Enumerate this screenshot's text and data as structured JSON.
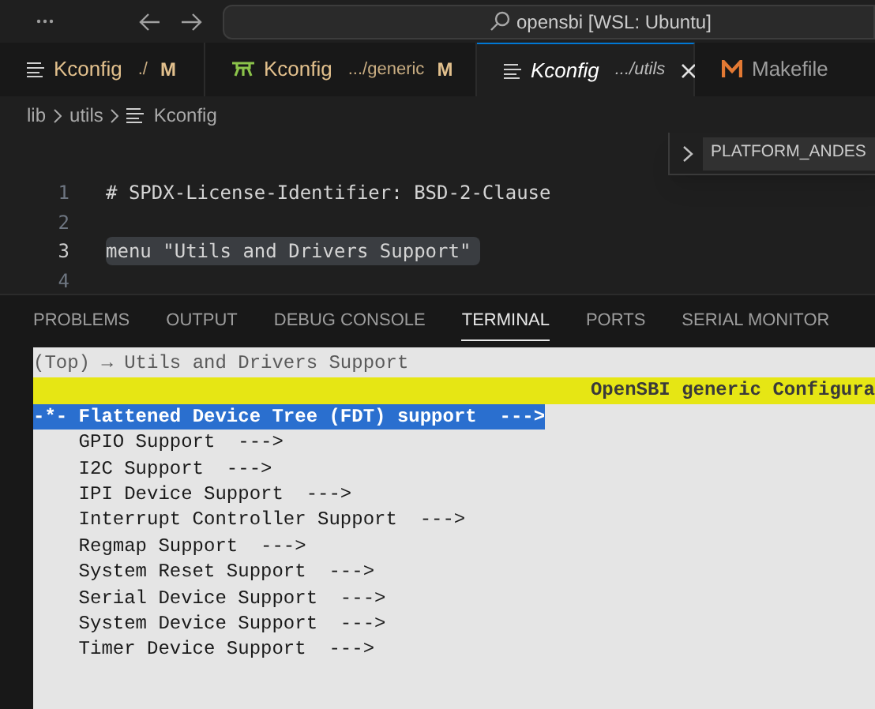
{
  "title_bar": {
    "search_text": "opensbi [WSL: Ubuntu]"
  },
  "tabs": [
    {
      "kind": "lines",
      "label": "Kconfig",
      "description": "./",
      "decoration": "M",
      "selected": false,
      "preview": false,
      "closable": false
    },
    {
      "kind": "tree",
      "label": "Kconfig",
      "description": ".../generic",
      "decoration": "M",
      "selected": false,
      "preview": false,
      "closable": false
    },
    {
      "kind": "lines",
      "label": "Kconfig",
      "description": ".../utils",
      "selected": true,
      "preview": true,
      "closable": true
    },
    {
      "kind": "m",
      "label": "Makefile",
      "selected": false,
      "preview": false,
      "closable": false
    }
  ],
  "breadcrumb": [
    "lib",
    "utils",
    "Kconfig"
  ],
  "find_widget": {
    "value": "PLATFORM_ANDES"
  },
  "editor_lines": [
    {
      "number": "1",
      "text": "# SPDX-License-Identifier: BSD-2-Clause",
      "current": false
    },
    {
      "number": "2",
      "current": false
    },
    {
      "number": "3",
      "text": "menu \"Utils and Drivers Support\"",
      "current": true
    },
    {
      "number": "4",
      "current": false
    }
  ],
  "panel_tabs": [
    {
      "label": "PROBLEMS",
      "selected": false
    },
    {
      "label": "OUTPUT",
      "selected": false
    },
    {
      "label": "DEBUG CONSOLE",
      "selected": false
    },
    {
      "label": "TERMINAL",
      "selected": true
    },
    {
      "label": "PORTS",
      "selected": false
    },
    {
      "label": "SERIAL MONITOR",
      "selected": false
    }
  ],
  "terminal": {
    "breadcrumb": "(Top) → Utils and Drivers Support",
    "banner": "OpenSBI generic Configura",
    "items": [
      {
        "prefix": "-*-",
        "text": "Flattened Device Tree (FDT) support  --->",
        "selected": true
      },
      {
        "text": "GPIO Support  --->",
        "selected": false
      },
      {
        "text": "I2C Support  --->",
        "selected": false
      },
      {
        "text": "IPI Device Support  --->",
        "selected": false
      },
      {
        "text": "Interrupt Controller Support  --->",
        "selected": false
      },
      {
        "text": "Regmap Support  --->",
        "selected": false
      },
      {
        "text": "System Reset Support  --->",
        "selected": false
      },
      {
        "text": "Serial Device Support  --->",
        "selected": false
      },
      {
        "text": "System Device Support  --->",
        "selected": false
      },
      {
        "text": "Timer Device Support  --->",
        "selected": false
      }
    ]
  }
}
